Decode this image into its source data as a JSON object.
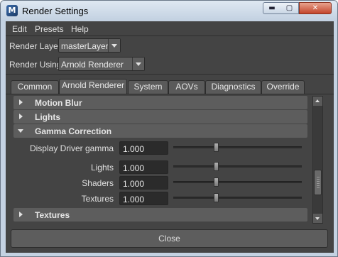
{
  "window": {
    "title": "Render Settings",
    "app_icon": "M",
    "buttons": {
      "minimize": "▬",
      "maximize": "▢",
      "close": "✕"
    }
  },
  "menubar": {
    "items": [
      "Edit",
      "Presets",
      "Help"
    ]
  },
  "render_layer": {
    "label": "Render Layer",
    "value": "masterLayer"
  },
  "render_using": {
    "label": "Render Using",
    "value": "Arnold Renderer"
  },
  "tabs": [
    {
      "label": "Common",
      "active": false
    },
    {
      "label": "Arnold Renderer",
      "active": true
    },
    {
      "label": "System",
      "active": false
    },
    {
      "label": "AOVs",
      "active": false
    },
    {
      "label": "Diagnostics",
      "active": false
    },
    {
      "label": "Override",
      "active": false
    }
  ],
  "sections": {
    "motion_blur": {
      "title": "Motion Blur",
      "expanded": false
    },
    "lights": {
      "title": "Lights",
      "expanded": false
    },
    "gamma_correction": {
      "title": "Gamma Correction",
      "expanded": true
    },
    "textures": {
      "title": "Textures",
      "expanded": false
    }
  },
  "gamma": {
    "display_driver": {
      "label": "Display Driver gamma",
      "value": "1.000",
      "slider_fraction": 0.33
    },
    "lights": {
      "label": "Lights",
      "value": "1.000",
      "slider_fraction": 0.33
    },
    "shaders": {
      "label": "Shaders",
      "value": "1.000",
      "slider_fraction": 0.33
    },
    "textures": {
      "label": "Textures",
      "value": "1.000",
      "slider_fraction": 0.33
    }
  },
  "scrollbar": {
    "position_fraction": 0.78
  },
  "footer": {
    "close_label": "Close"
  },
  "colors": {
    "panel": "#444444",
    "section_header": "#5d5d5d",
    "field": "#2b2b2b",
    "frame": "#c4d2e2"
  }
}
